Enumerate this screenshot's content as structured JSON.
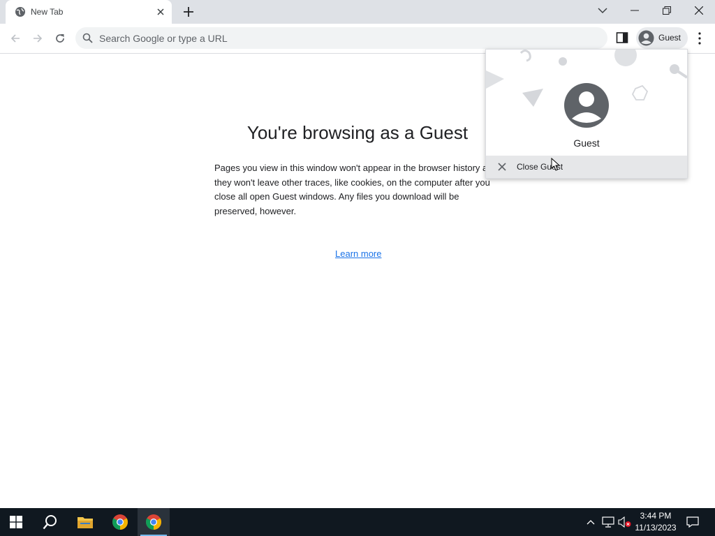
{
  "tab": {
    "title": "New Tab"
  },
  "omnibox": {
    "placeholder": "Search Google or type a URL"
  },
  "toolbar": {
    "profile_label": "Guest"
  },
  "main": {
    "headline": "You're browsing as a Guest",
    "description": "Pages you view in this window won't appear in the browser history and they won't leave other traces, like cookies, on the computer after you close all open Guest windows. Any files you download will be preserved, however.",
    "learn_more": "Learn more"
  },
  "profile_menu": {
    "name": "Guest",
    "close_label": "Close Guest"
  },
  "taskbar": {
    "time": "3:44 PM",
    "date": "11/13/2023"
  },
  "colors": {
    "link": "#1a73e8",
    "tabstrip": "#dee1e6",
    "taskbar": "#101820",
    "accent": "#76b9ed"
  }
}
